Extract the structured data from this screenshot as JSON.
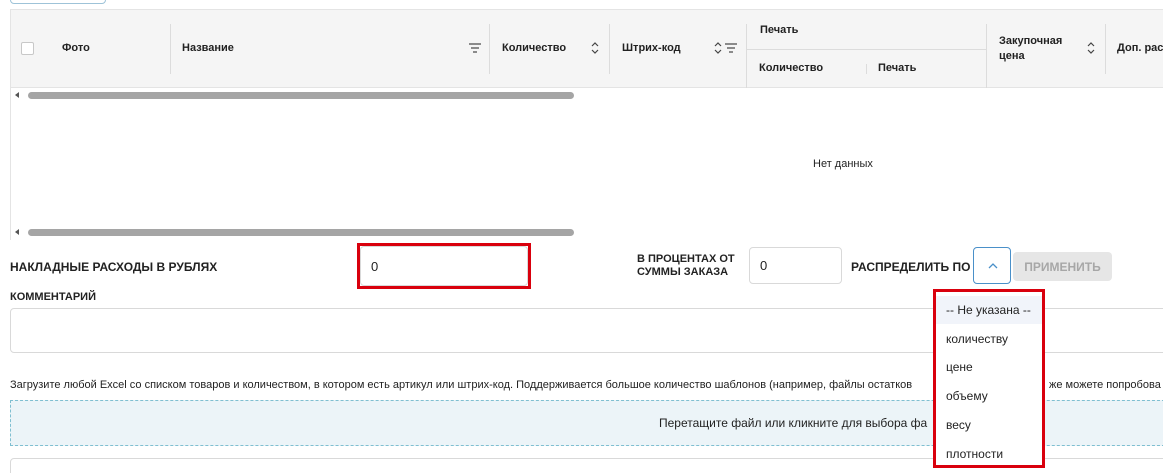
{
  "table": {
    "columns": {
      "photo": "Фото",
      "name": "Название",
      "quantity": "Количество",
      "barcode": "Штрих-код",
      "print_group": "Печать",
      "print_quantity": "Количество",
      "print_print": "Печать",
      "purchase_price_line1": "Закупочная",
      "purchase_price_line2": "цена",
      "extra": "Доп. рас"
    },
    "empty_text": "Нет данных"
  },
  "form": {
    "overhead_label": "НАКЛАДНЫЕ РАСХОДЫ В РУБЛЯХ",
    "overhead_value": "0",
    "percent_label_line1": "В ПРОЦЕНТАХ ОТ",
    "percent_label_line2": "СУММЫ ЗАКАЗА",
    "percent_value": "0",
    "distribute_label": "РАСПРЕДЕЛИТЬ ПО",
    "apply_button": "ПРИМЕНИТЬ",
    "comment_label": "КОММЕНТАРИЙ"
  },
  "upload": {
    "info_text": "Загрузите любой Excel со списком товаров и количеством, в котором есть артикул или штрих-код. Поддерживается большое количество шаблонов (например, файлы остатков",
    "info_text_tail": "же можете попробова",
    "dropzone_text": "Перетащите файл или кликните для выбора фа"
  },
  "dropdown": {
    "options": [
      "-- Не указана --",
      "количеству",
      "цене",
      "объему",
      "весу",
      "плотности"
    ],
    "selected_index": 0
  },
  "colors": {
    "highlight": "#d9000d",
    "accent": "#4a90c9",
    "dropzone_bg": "#ecf4f8"
  }
}
